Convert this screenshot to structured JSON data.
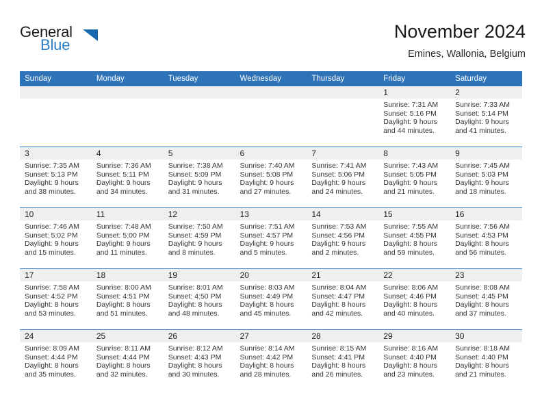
{
  "brand": {
    "name_part1": "General",
    "name_part2": "Blue",
    "logo_icon": "triangle-logo-icon",
    "accent_color": "#2b7cc4"
  },
  "header": {
    "title": "November 2024",
    "location": "Emines, Wallonia, Belgium"
  },
  "theme": {
    "header_blue": "#2e72b8",
    "date_band_gray": "#efefef",
    "row_divider": "#3a7cbd"
  },
  "weekday_headers": [
    "Sunday",
    "Monday",
    "Tuesday",
    "Wednesday",
    "Thursday",
    "Friday",
    "Saturday"
  ],
  "weeks": [
    [
      {
        "day": "",
        "empty": true
      },
      {
        "day": "",
        "empty": true
      },
      {
        "day": "",
        "empty": true
      },
      {
        "day": "",
        "empty": true
      },
      {
        "day": "",
        "empty": true
      },
      {
        "day": "1",
        "sunrise": "Sunrise: 7:31 AM",
        "sunset": "Sunset: 5:16 PM",
        "daylight_line1": "Daylight: 9 hours",
        "daylight_line2": "and 44 minutes."
      },
      {
        "day": "2",
        "sunrise": "Sunrise: 7:33 AM",
        "sunset": "Sunset: 5:14 PM",
        "daylight_line1": "Daylight: 9 hours",
        "daylight_line2": "and 41 minutes."
      }
    ],
    [
      {
        "day": "3",
        "sunrise": "Sunrise: 7:35 AM",
        "sunset": "Sunset: 5:13 PM",
        "daylight_line1": "Daylight: 9 hours",
        "daylight_line2": "and 38 minutes."
      },
      {
        "day": "4",
        "sunrise": "Sunrise: 7:36 AM",
        "sunset": "Sunset: 5:11 PM",
        "daylight_line1": "Daylight: 9 hours",
        "daylight_line2": "and 34 minutes."
      },
      {
        "day": "5",
        "sunrise": "Sunrise: 7:38 AM",
        "sunset": "Sunset: 5:09 PM",
        "daylight_line1": "Daylight: 9 hours",
        "daylight_line2": "and 31 minutes."
      },
      {
        "day": "6",
        "sunrise": "Sunrise: 7:40 AM",
        "sunset": "Sunset: 5:08 PM",
        "daylight_line1": "Daylight: 9 hours",
        "daylight_line2": "and 27 minutes."
      },
      {
        "day": "7",
        "sunrise": "Sunrise: 7:41 AM",
        "sunset": "Sunset: 5:06 PM",
        "daylight_line1": "Daylight: 9 hours",
        "daylight_line2": "and 24 minutes."
      },
      {
        "day": "8",
        "sunrise": "Sunrise: 7:43 AM",
        "sunset": "Sunset: 5:05 PM",
        "daylight_line1": "Daylight: 9 hours",
        "daylight_line2": "and 21 minutes."
      },
      {
        "day": "9",
        "sunrise": "Sunrise: 7:45 AM",
        "sunset": "Sunset: 5:03 PM",
        "daylight_line1": "Daylight: 9 hours",
        "daylight_line2": "and 18 minutes."
      }
    ],
    [
      {
        "day": "10",
        "sunrise": "Sunrise: 7:46 AM",
        "sunset": "Sunset: 5:02 PM",
        "daylight_line1": "Daylight: 9 hours",
        "daylight_line2": "and 15 minutes."
      },
      {
        "day": "11",
        "sunrise": "Sunrise: 7:48 AM",
        "sunset": "Sunset: 5:00 PM",
        "daylight_line1": "Daylight: 9 hours",
        "daylight_line2": "and 11 minutes."
      },
      {
        "day": "12",
        "sunrise": "Sunrise: 7:50 AM",
        "sunset": "Sunset: 4:59 PM",
        "daylight_line1": "Daylight: 9 hours",
        "daylight_line2": "and 8 minutes."
      },
      {
        "day": "13",
        "sunrise": "Sunrise: 7:51 AM",
        "sunset": "Sunset: 4:57 PM",
        "daylight_line1": "Daylight: 9 hours",
        "daylight_line2": "and 5 minutes."
      },
      {
        "day": "14",
        "sunrise": "Sunrise: 7:53 AM",
        "sunset": "Sunset: 4:56 PM",
        "daylight_line1": "Daylight: 9 hours",
        "daylight_line2": "and 2 minutes."
      },
      {
        "day": "15",
        "sunrise": "Sunrise: 7:55 AM",
        "sunset": "Sunset: 4:55 PM",
        "daylight_line1": "Daylight: 8 hours",
        "daylight_line2": "and 59 minutes."
      },
      {
        "day": "16",
        "sunrise": "Sunrise: 7:56 AM",
        "sunset": "Sunset: 4:53 PM",
        "daylight_line1": "Daylight: 8 hours",
        "daylight_line2": "and 56 minutes."
      }
    ],
    [
      {
        "day": "17",
        "sunrise": "Sunrise: 7:58 AM",
        "sunset": "Sunset: 4:52 PM",
        "daylight_line1": "Daylight: 8 hours",
        "daylight_line2": "and 53 minutes."
      },
      {
        "day": "18",
        "sunrise": "Sunrise: 8:00 AM",
        "sunset": "Sunset: 4:51 PM",
        "daylight_line1": "Daylight: 8 hours",
        "daylight_line2": "and 51 minutes."
      },
      {
        "day": "19",
        "sunrise": "Sunrise: 8:01 AM",
        "sunset": "Sunset: 4:50 PM",
        "daylight_line1": "Daylight: 8 hours",
        "daylight_line2": "and 48 minutes."
      },
      {
        "day": "20",
        "sunrise": "Sunrise: 8:03 AM",
        "sunset": "Sunset: 4:49 PM",
        "daylight_line1": "Daylight: 8 hours",
        "daylight_line2": "and 45 minutes."
      },
      {
        "day": "21",
        "sunrise": "Sunrise: 8:04 AM",
        "sunset": "Sunset: 4:47 PM",
        "daylight_line1": "Daylight: 8 hours",
        "daylight_line2": "and 42 minutes."
      },
      {
        "day": "22",
        "sunrise": "Sunrise: 8:06 AM",
        "sunset": "Sunset: 4:46 PM",
        "daylight_line1": "Daylight: 8 hours",
        "daylight_line2": "and 40 minutes."
      },
      {
        "day": "23",
        "sunrise": "Sunrise: 8:08 AM",
        "sunset": "Sunset: 4:45 PM",
        "daylight_line1": "Daylight: 8 hours",
        "daylight_line2": "and 37 minutes."
      }
    ],
    [
      {
        "day": "24",
        "sunrise": "Sunrise: 8:09 AM",
        "sunset": "Sunset: 4:44 PM",
        "daylight_line1": "Daylight: 8 hours",
        "daylight_line2": "and 35 minutes."
      },
      {
        "day": "25",
        "sunrise": "Sunrise: 8:11 AM",
        "sunset": "Sunset: 4:44 PM",
        "daylight_line1": "Daylight: 8 hours",
        "daylight_line2": "and 32 minutes."
      },
      {
        "day": "26",
        "sunrise": "Sunrise: 8:12 AM",
        "sunset": "Sunset: 4:43 PM",
        "daylight_line1": "Daylight: 8 hours",
        "daylight_line2": "and 30 minutes."
      },
      {
        "day": "27",
        "sunrise": "Sunrise: 8:14 AM",
        "sunset": "Sunset: 4:42 PM",
        "daylight_line1": "Daylight: 8 hours",
        "daylight_line2": "and 28 minutes."
      },
      {
        "day": "28",
        "sunrise": "Sunrise: 8:15 AM",
        "sunset": "Sunset: 4:41 PM",
        "daylight_line1": "Daylight: 8 hours",
        "daylight_line2": "and 26 minutes."
      },
      {
        "day": "29",
        "sunrise": "Sunrise: 8:16 AM",
        "sunset": "Sunset: 4:40 PM",
        "daylight_line1": "Daylight: 8 hours",
        "daylight_line2": "and 23 minutes."
      },
      {
        "day": "30",
        "sunrise": "Sunrise: 8:18 AM",
        "sunset": "Sunset: 4:40 PM",
        "daylight_line1": "Daylight: 8 hours",
        "daylight_line2": "and 21 minutes."
      }
    ]
  ]
}
